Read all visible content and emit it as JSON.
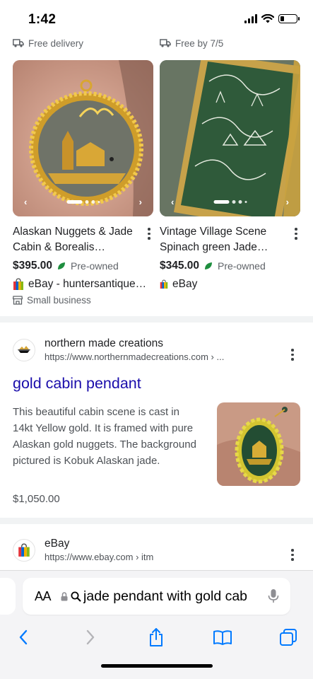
{
  "status_bar": {
    "time": "1:42",
    "battery_level": 0.25
  },
  "shopping": {
    "items": [
      {
        "delivery": "Free delivery",
        "title": "Alaskan Nuggets & Jade Cabin & Borealis…",
        "price": "$395.00",
        "condition": "Pre-owned",
        "seller": "eBay - huntersantique…",
        "badge": "Small business"
      },
      {
        "delivery": "Free by 7/5",
        "title": "Vintage Village Scene Spinach green Jade…",
        "price": "$345.00",
        "condition": "Pre-owned",
        "seller": "eBay"
      }
    ]
  },
  "result1": {
    "source": "northern made creations",
    "url": "https://www.northernmadecreations.com › ...",
    "title": "gold cabin pendant",
    "snippet": "This beautiful cabin scene is cast in 14kt Yellow gold. It is framed with pure Alaskan gold nuggets. The background pictured is Kobuk Alaskan jade.",
    "price": "$1,050.00"
  },
  "result2": {
    "source": "eBay",
    "url": "https://www.ebay.com › itm"
  },
  "address_bar": {
    "aa_label": "AA",
    "query": "jade pendant with gold cabin"
  },
  "colors": {
    "link": "#1a0dab",
    "accent": "#007aff",
    "leaf": "#1e8e3e"
  },
  "icons": {
    "back": "chevron-left-icon",
    "forward": "chevron-right-icon",
    "share": "share-icon",
    "bookmarks": "book-icon",
    "tabs": "tabs-icon"
  }
}
